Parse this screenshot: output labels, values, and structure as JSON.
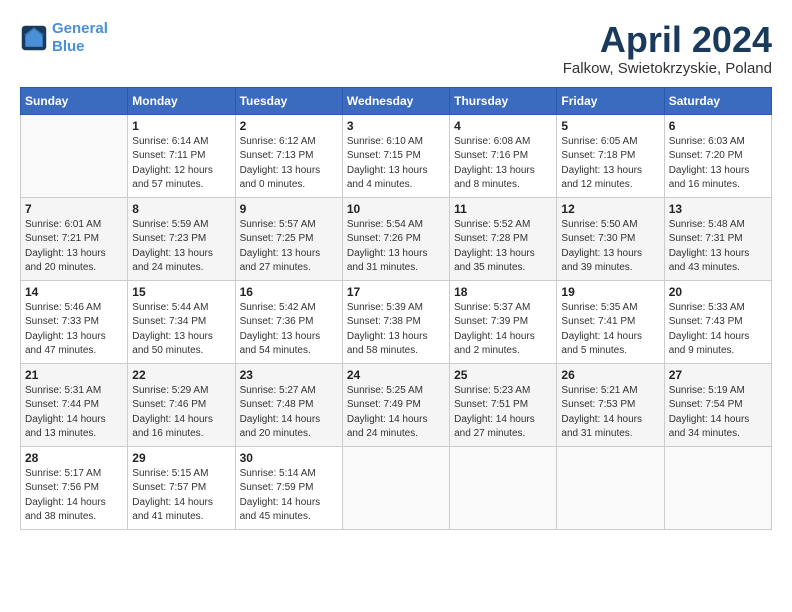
{
  "header": {
    "logo_line1": "General",
    "logo_line2": "Blue",
    "title": "April 2024",
    "location": "Falkow, Swietokrzyskie, Poland"
  },
  "days_of_week": [
    "Sunday",
    "Monday",
    "Tuesday",
    "Wednesday",
    "Thursday",
    "Friday",
    "Saturday"
  ],
  "weeks": [
    [
      {
        "day": "",
        "info": ""
      },
      {
        "day": "1",
        "info": "Sunrise: 6:14 AM\nSunset: 7:11 PM\nDaylight: 12 hours\nand 57 minutes."
      },
      {
        "day": "2",
        "info": "Sunrise: 6:12 AM\nSunset: 7:13 PM\nDaylight: 13 hours\nand 0 minutes."
      },
      {
        "day": "3",
        "info": "Sunrise: 6:10 AM\nSunset: 7:15 PM\nDaylight: 13 hours\nand 4 minutes."
      },
      {
        "day": "4",
        "info": "Sunrise: 6:08 AM\nSunset: 7:16 PM\nDaylight: 13 hours\nand 8 minutes."
      },
      {
        "day": "5",
        "info": "Sunrise: 6:05 AM\nSunset: 7:18 PM\nDaylight: 13 hours\nand 12 minutes."
      },
      {
        "day": "6",
        "info": "Sunrise: 6:03 AM\nSunset: 7:20 PM\nDaylight: 13 hours\nand 16 minutes."
      }
    ],
    [
      {
        "day": "7",
        "info": "Sunrise: 6:01 AM\nSunset: 7:21 PM\nDaylight: 13 hours\nand 20 minutes."
      },
      {
        "day": "8",
        "info": "Sunrise: 5:59 AM\nSunset: 7:23 PM\nDaylight: 13 hours\nand 24 minutes."
      },
      {
        "day": "9",
        "info": "Sunrise: 5:57 AM\nSunset: 7:25 PM\nDaylight: 13 hours\nand 27 minutes."
      },
      {
        "day": "10",
        "info": "Sunrise: 5:54 AM\nSunset: 7:26 PM\nDaylight: 13 hours\nand 31 minutes."
      },
      {
        "day": "11",
        "info": "Sunrise: 5:52 AM\nSunset: 7:28 PM\nDaylight: 13 hours\nand 35 minutes."
      },
      {
        "day": "12",
        "info": "Sunrise: 5:50 AM\nSunset: 7:30 PM\nDaylight: 13 hours\nand 39 minutes."
      },
      {
        "day": "13",
        "info": "Sunrise: 5:48 AM\nSunset: 7:31 PM\nDaylight: 13 hours\nand 43 minutes."
      }
    ],
    [
      {
        "day": "14",
        "info": "Sunrise: 5:46 AM\nSunset: 7:33 PM\nDaylight: 13 hours\nand 47 minutes."
      },
      {
        "day": "15",
        "info": "Sunrise: 5:44 AM\nSunset: 7:34 PM\nDaylight: 13 hours\nand 50 minutes."
      },
      {
        "day": "16",
        "info": "Sunrise: 5:42 AM\nSunset: 7:36 PM\nDaylight: 13 hours\nand 54 minutes."
      },
      {
        "day": "17",
        "info": "Sunrise: 5:39 AM\nSunset: 7:38 PM\nDaylight: 13 hours\nand 58 minutes."
      },
      {
        "day": "18",
        "info": "Sunrise: 5:37 AM\nSunset: 7:39 PM\nDaylight: 14 hours\nand 2 minutes."
      },
      {
        "day": "19",
        "info": "Sunrise: 5:35 AM\nSunset: 7:41 PM\nDaylight: 14 hours\nand 5 minutes."
      },
      {
        "day": "20",
        "info": "Sunrise: 5:33 AM\nSunset: 7:43 PM\nDaylight: 14 hours\nand 9 minutes."
      }
    ],
    [
      {
        "day": "21",
        "info": "Sunrise: 5:31 AM\nSunset: 7:44 PM\nDaylight: 14 hours\nand 13 minutes."
      },
      {
        "day": "22",
        "info": "Sunrise: 5:29 AM\nSunset: 7:46 PM\nDaylight: 14 hours\nand 16 minutes."
      },
      {
        "day": "23",
        "info": "Sunrise: 5:27 AM\nSunset: 7:48 PM\nDaylight: 14 hours\nand 20 minutes."
      },
      {
        "day": "24",
        "info": "Sunrise: 5:25 AM\nSunset: 7:49 PM\nDaylight: 14 hours\nand 24 minutes."
      },
      {
        "day": "25",
        "info": "Sunrise: 5:23 AM\nSunset: 7:51 PM\nDaylight: 14 hours\nand 27 minutes."
      },
      {
        "day": "26",
        "info": "Sunrise: 5:21 AM\nSunset: 7:53 PM\nDaylight: 14 hours\nand 31 minutes."
      },
      {
        "day": "27",
        "info": "Sunrise: 5:19 AM\nSunset: 7:54 PM\nDaylight: 14 hours\nand 34 minutes."
      }
    ],
    [
      {
        "day": "28",
        "info": "Sunrise: 5:17 AM\nSunset: 7:56 PM\nDaylight: 14 hours\nand 38 minutes."
      },
      {
        "day": "29",
        "info": "Sunrise: 5:15 AM\nSunset: 7:57 PM\nDaylight: 14 hours\nand 41 minutes."
      },
      {
        "day": "30",
        "info": "Sunrise: 5:14 AM\nSunset: 7:59 PM\nDaylight: 14 hours\nand 45 minutes."
      },
      {
        "day": "",
        "info": ""
      },
      {
        "day": "",
        "info": ""
      },
      {
        "day": "",
        "info": ""
      },
      {
        "day": "",
        "info": ""
      }
    ]
  ]
}
